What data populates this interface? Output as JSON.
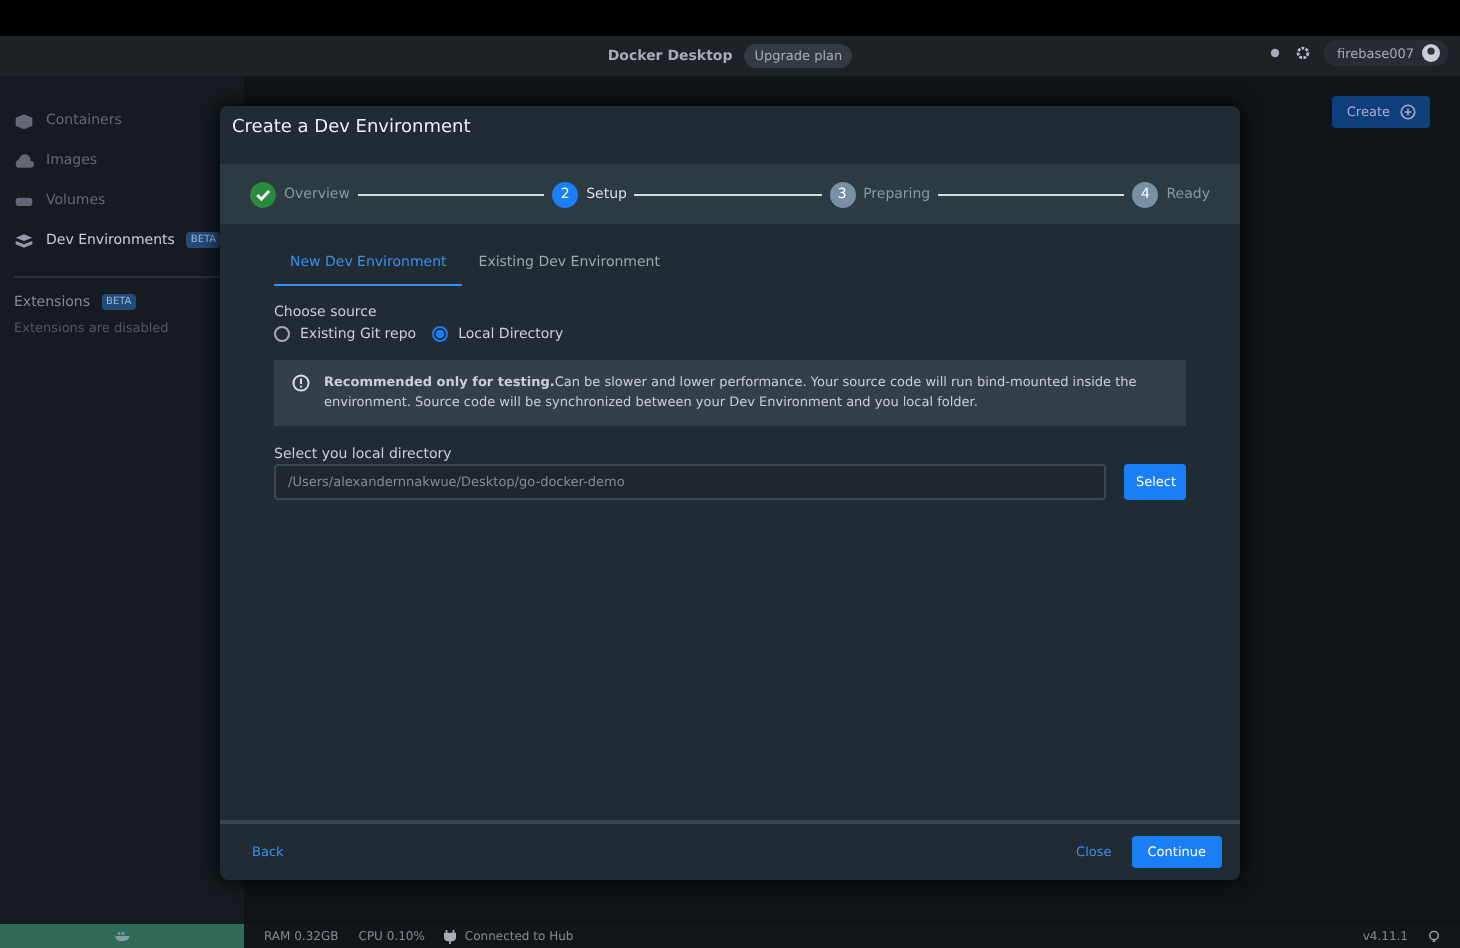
{
  "titlebar": {
    "title": "Docker Desktop",
    "upgrade": "Upgrade plan",
    "user": "firebase007"
  },
  "sidebar": {
    "items": [
      {
        "label": "Containers",
        "selected": false,
        "kind": "containers"
      },
      {
        "label": "Images",
        "selected": false,
        "kind": "images"
      },
      {
        "label": "Volumes",
        "selected": false,
        "kind": "volumes"
      },
      {
        "label": "Dev Environments",
        "selected": true,
        "kind": "dev",
        "badge": "BETA"
      }
    ],
    "extensions": {
      "label": "Extensions",
      "badge": "BETA",
      "note": "Extensions are disabled"
    }
  },
  "main": {
    "create_button": "Create"
  },
  "dialog": {
    "title": "Create a Dev Environment",
    "steps": [
      {
        "label": "Overview",
        "completed": true,
        "selected": false
      },
      {
        "number": "2",
        "label": "Setup",
        "completed": false,
        "selected": true
      },
      {
        "number": "3",
        "label": "Preparing",
        "completed": false,
        "selected": false
      },
      {
        "number": "4",
        "label": "Ready",
        "completed": false,
        "selected": false
      }
    ],
    "tabs": [
      {
        "label": "New Dev Environment",
        "selected": true
      },
      {
        "label": "Existing Dev Environment",
        "selected": false
      }
    ],
    "source_label": "Choose source",
    "sources": [
      {
        "label": "Existing Git repo",
        "selected": false
      },
      {
        "label": "Local Directory",
        "selected": true
      }
    ],
    "notice": "**Recommended only for testing.**Can be slower and lower performance. Your source code will run bind-mounted inside the environment. Source code will be synchronized between your Dev Environment and you local folder.",
    "directory_label": "Select you local directory",
    "directory_value": "/Users/alexandernnakwue/Desktop/go-docker-demo",
    "select_button": "Select",
    "back": "Back",
    "close": "Close",
    "continue": "Continue"
  },
  "status_bar": {
    "ram": "RAM 0.32GB",
    "cpu": "CPU 0.10%",
    "hub": "Connected to Hub",
    "version": "v4.11.1"
  }
}
